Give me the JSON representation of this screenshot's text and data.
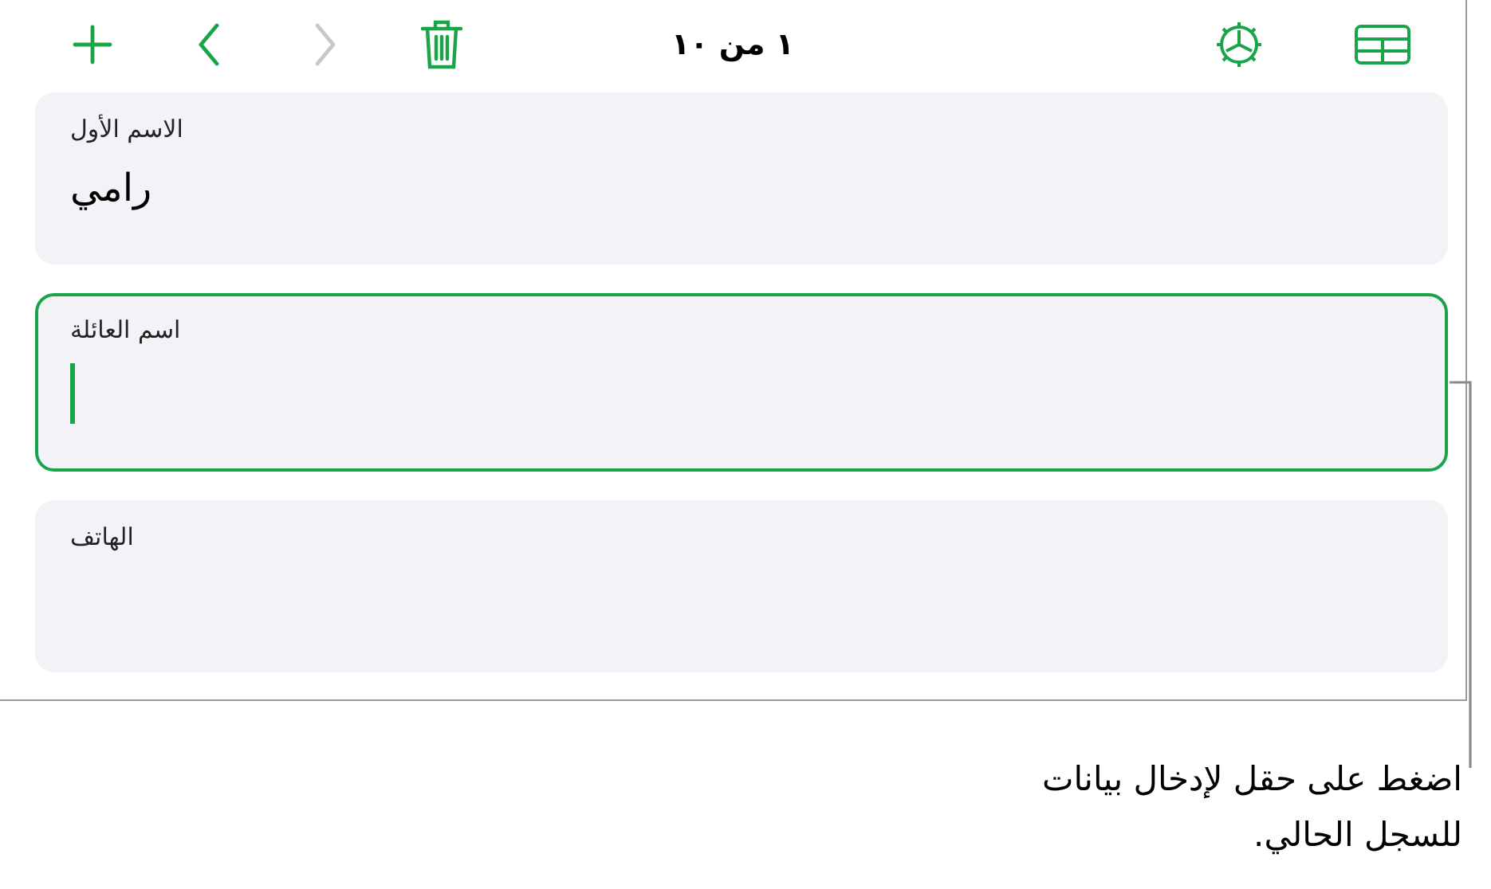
{
  "toolbar": {
    "title": "١ من ١٠",
    "nav_buttons": [
      {
        "kind": "add",
        "disabled": false
      },
      {
        "kind": "back",
        "disabled": false
      },
      {
        "kind": "forward",
        "disabled": true
      },
      {
        "kind": "delete",
        "disabled": false
      }
    ],
    "tool_buttons": [
      {
        "kind": "format"
      },
      {
        "kind": "table"
      }
    ]
  },
  "fields": [
    {
      "label": "الاسم الأول",
      "value": "رامي",
      "selected": false
    },
    {
      "label": "اسم العائلة",
      "selected": true
    },
    {
      "label": "الهاتف",
      "selected": false
    }
  ],
  "callout": {
    "text": "اضغط على حقل لإدخال بيانات للسجل الحالي."
  }
}
